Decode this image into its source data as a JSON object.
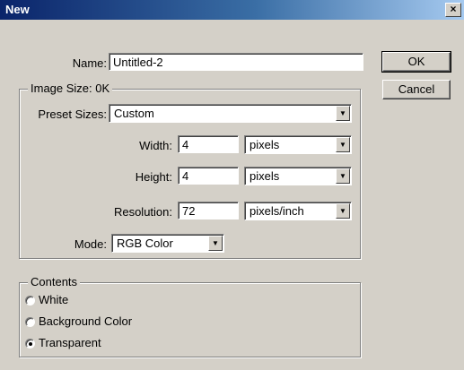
{
  "window": {
    "title": "New",
    "close_glyph": "×"
  },
  "name_field": {
    "label": "Name:",
    "value": "Untitled-2"
  },
  "buttons": {
    "ok": "OK",
    "cancel": "Cancel"
  },
  "image_size": {
    "legend": "Image Size: 0K",
    "preset": {
      "label": "Preset Sizes:",
      "value": "Custom"
    },
    "width": {
      "label": "Width:",
      "value": "4",
      "unit": "pixels"
    },
    "height": {
      "label": "Height:",
      "value": "4",
      "unit": "pixels"
    },
    "resolution": {
      "label": "Resolution:",
      "value": "72",
      "unit": "pixels/inch"
    },
    "mode": {
      "label": "Mode:",
      "value": "RGB Color"
    }
  },
  "contents": {
    "legend": "Contents",
    "options": [
      {
        "label": "White",
        "checked": false
      },
      {
        "label": "Background Color",
        "checked": false
      },
      {
        "label": "Transparent",
        "checked": true
      }
    ]
  },
  "icons": {
    "dropdown_arrow": "chevron-down-icon",
    "close": "close-icon"
  },
  "colors": {
    "dialog_bg": "#d4d0c8",
    "titlebar_start": "#0a246a",
    "titlebar_end": "#a6caf0"
  }
}
